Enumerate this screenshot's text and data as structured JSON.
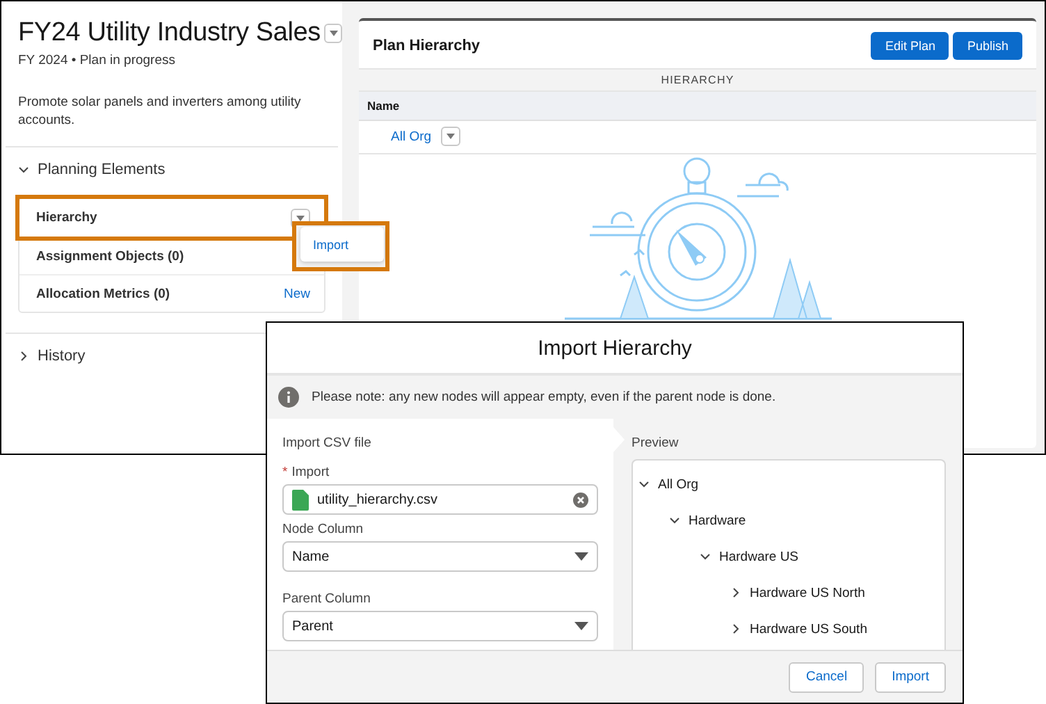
{
  "plan": {
    "title": "FY24 Utility Industry Sales",
    "subtitle": "FY 2024 • Plan in progress",
    "description": "Promote solar panels and inverters among utility accounts."
  },
  "sections": [
    {
      "label": "Planning Elements",
      "expanded": true,
      "items": [
        {
          "label": "Hierarchy",
          "highlighted": true,
          "kind": "menu"
        },
        {
          "label": "Assignment Objects (0)",
          "highlighted": false,
          "kind": "plain"
        },
        {
          "label": "Allocation Metrics (0)",
          "highlighted": false,
          "kind": "link",
          "action": "New"
        }
      ]
    },
    {
      "label": "History",
      "expanded": false
    }
  ],
  "context_menu": {
    "items": [
      "Import"
    ]
  },
  "hierarchy_panel": {
    "title": "Plan Hierarchy",
    "buttons": [
      "Edit Plan",
      "Publish"
    ],
    "band": "HIERARCHY",
    "columns": [
      "Name"
    ],
    "rows": [
      {
        "name": "All Org"
      }
    ]
  },
  "dialog": {
    "title": "Import Hierarchy",
    "notice": "Please note: any new nodes will appear empty, even if the parent node is done.",
    "form_title": "Import CSV file",
    "file_field": {
      "label": "Import",
      "required": true,
      "required_mark": "*",
      "value": "utility_hierarchy.csv"
    },
    "selects": [
      {
        "label": "Node Column",
        "value": "Name"
      },
      {
        "label": "Parent Column",
        "value": "Parent"
      }
    ],
    "preview": {
      "title": "Preview",
      "tree": [
        {
          "label": "All Org",
          "expanded": true,
          "children": [
            {
              "label": "Hardware",
              "expanded": true,
              "children": [
                {
                  "label": "Hardware US",
                  "expanded": true,
                  "children": [
                    {
                      "label": "Hardware US North",
                      "expanded": false
                    },
                    {
                      "label": "Hardware US South",
                      "expanded": false
                    }
                  ]
                }
              ]
            }
          ]
        }
      ]
    },
    "buttons": [
      {
        "label": "Cancel"
      },
      {
        "label": "Import"
      }
    ]
  }
}
